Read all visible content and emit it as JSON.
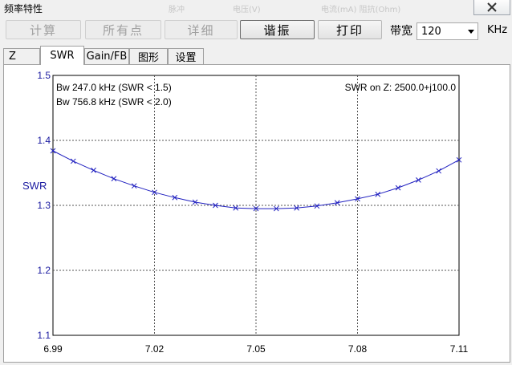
{
  "window": {
    "title": "频率特性",
    "ghost_text": [
      "脉冲",
      "电压(V)",
      "电流(mA) 阻抗(Ohm)"
    ]
  },
  "toolbar": {
    "buttons": [
      {
        "label": "计算",
        "enabled": false
      },
      {
        "label": "所有点",
        "enabled": false
      },
      {
        "label": "详细",
        "enabled": false
      },
      {
        "label": "谐振",
        "enabled": true
      },
      {
        "label": "打印",
        "enabled": true
      }
    ],
    "bandwidth_label": "带宽",
    "bandwidth_value": "120",
    "bandwidth_unit": "KHz"
  },
  "tabs": [
    {
      "label": "Z",
      "active": false
    },
    {
      "label": "SWR",
      "active": true
    },
    {
      "label": "Gain/FB",
      "active": false
    },
    {
      "label": "图形",
      "active": false
    },
    {
      "label": "设置",
      "active": false
    }
  ],
  "chart_data": {
    "type": "line",
    "ylabel": "SWR",
    "xlabel": "",
    "xlim": [
      6.99,
      7.11
    ],
    "ylim": [
      1.1,
      1.5
    ],
    "x_ticks": [
      "6.99",
      "7.02",
      "7.05",
      "7.08",
      "7.11"
    ],
    "y_ticks": [
      "1.5",
      "1.4",
      "1.3",
      "1.2",
      "1.1"
    ],
    "grid": true,
    "annotations": {
      "left": [
        "Bw 247.0 kHz (SWR < 1.5)",
        "Bw 756.8 kHz (SWR < 2.0)"
      ],
      "right": "SWR on Z: 2500.0+j100.0"
    },
    "series": [
      {
        "color": "#2020c0",
        "marker": "x",
        "x": [
          6.99,
          6.996,
          7.002,
          7.008,
          7.014,
          7.02,
          7.026,
          7.032,
          7.038,
          7.044,
          7.05,
          7.056,
          7.062,
          7.068,
          7.074,
          7.08,
          7.086,
          7.092,
          7.098,
          7.104,
          7.11
        ],
        "y": [
          1.384,
          1.368,
          1.354,
          1.341,
          1.33,
          1.32,
          1.312,
          1.305,
          1.3,
          1.296,
          1.295,
          1.295,
          1.296,
          1.299,
          1.304,
          1.31,
          1.317,
          1.327,
          1.339,
          1.353,
          1.37
        ]
      }
    ]
  }
}
